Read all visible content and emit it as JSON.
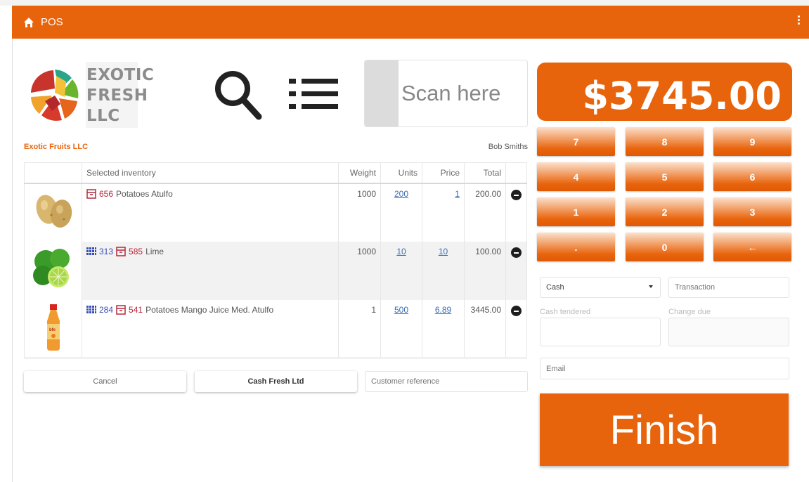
{
  "app": {
    "title": "POS"
  },
  "logo": {
    "line1": "EXOTIC",
    "line2": "FRESH",
    "line3": "LLC"
  },
  "scan": {
    "placeholder": "Scan here"
  },
  "company_name": "Exotic Fruits LLC",
  "user_name": "Bob Smiths",
  "table": {
    "headers": {
      "inventory": "Selected inventory",
      "weight": "Weight",
      "units": "Units",
      "price": "Price",
      "total": "Total"
    },
    "rows": [
      {
        "image": "potatoes",
        "codes": [
          {
            "kind": "box",
            "code": "656"
          }
        ],
        "name": "Potatoes Atulfo",
        "weight": "1000",
        "units": "200",
        "price": "1",
        "total": "200.00"
      },
      {
        "image": "lime",
        "codes": [
          {
            "kind": "grid",
            "code": "313"
          },
          {
            "kind": "box",
            "code": "585"
          }
        ],
        "name": "Lime",
        "weight": "1000",
        "units": "10",
        "price": "10",
        "total": "100.00"
      },
      {
        "image": "juice",
        "codes": [
          {
            "kind": "grid",
            "code": "284"
          },
          {
            "kind": "box",
            "code": "541"
          }
        ],
        "name": "Potatoes Mango Juice Med. Atulfo",
        "weight": "1",
        "units": "500",
        "price": "6.89",
        "total": "3445.00"
      }
    ]
  },
  "actions": {
    "cancel": "Cancel",
    "customer": "Cash Fresh Ltd",
    "customer_ref_placeholder": "Customer reference"
  },
  "total_display": "$3745.00",
  "keypad": [
    "7",
    "8",
    "9",
    "4",
    "5",
    "6",
    "1",
    "2",
    "3",
    ".",
    "0",
    "←"
  ],
  "payment": {
    "method": "Cash",
    "transaction_placeholder": "Transaction",
    "cash_tendered_label": "Cash tendered",
    "change_due_label": "Change due",
    "email_placeholder": "Email"
  },
  "finish_label": "Finish",
  "colors": {
    "accent": "#e8640c",
    "link": "#3a6db5",
    "code_blue": "#3a4fb5",
    "code_red": "#b5283a"
  }
}
